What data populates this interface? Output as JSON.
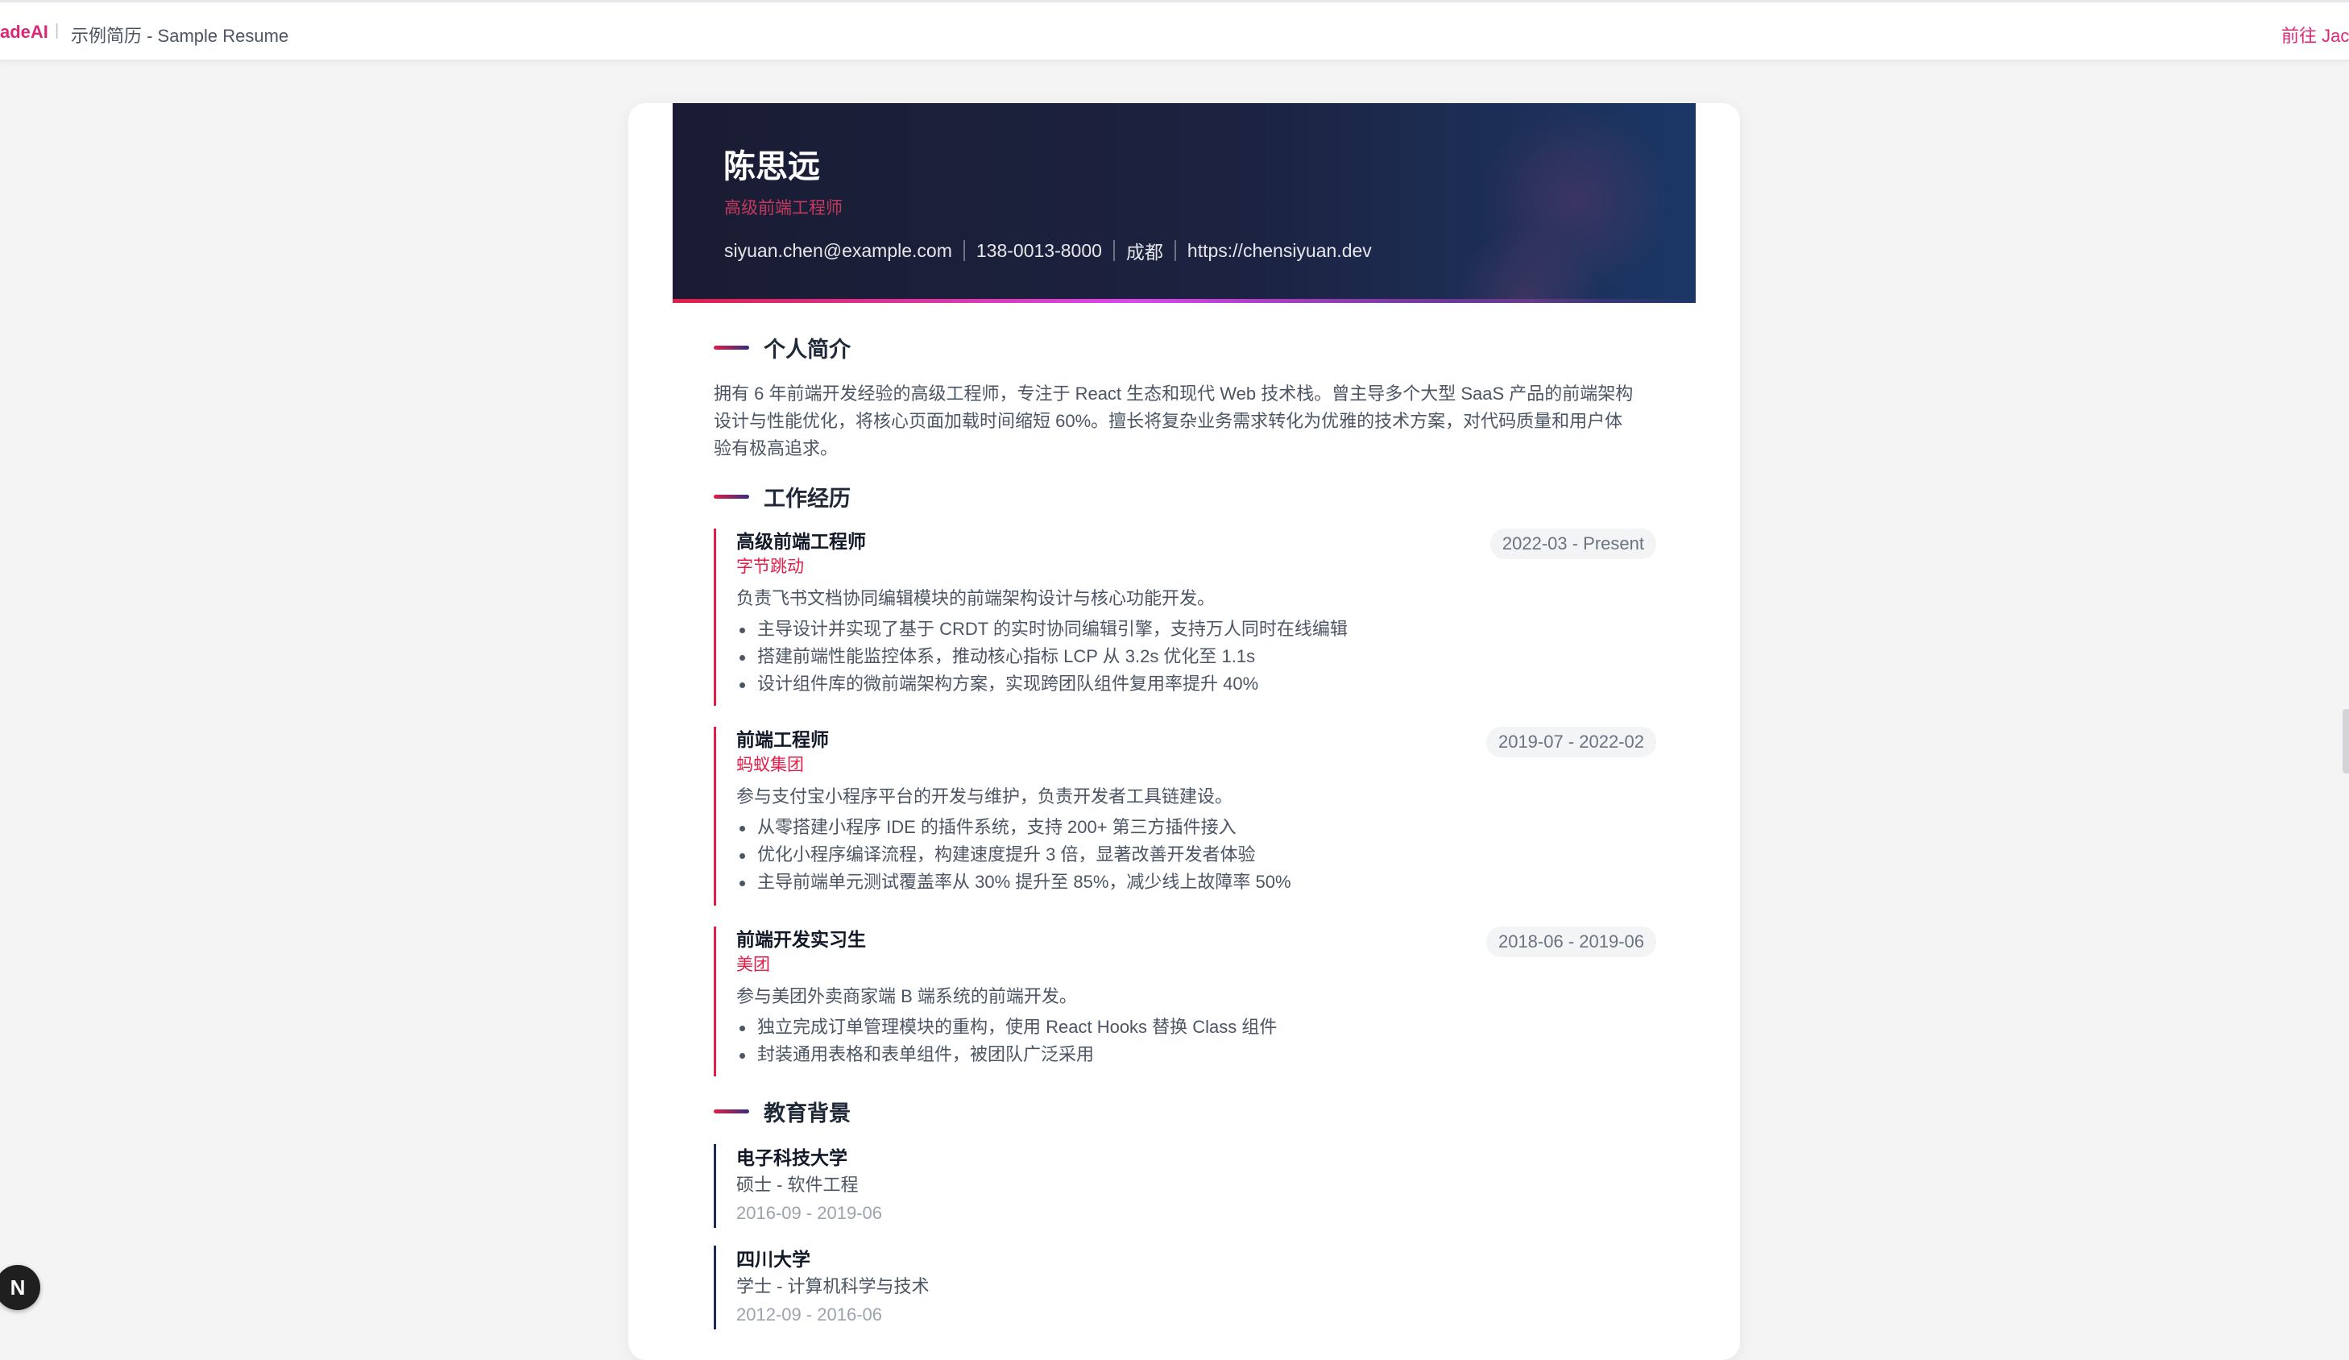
{
  "topbar": {
    "brand": "adeAI",
    "separator": "|",
    "breadcrumb": "示例简历 - Sample Resume",
    "goto_label": "前往 Jac"
  },
  "resume": {
    "name": "陈思远",
    "title": "高级前端工程师",
    "contacts": {
      "email": "siyuan.chen@example.com",
      "phone": "138-0013-8000",
      "city": "成都",
      "website": "https://chensiyuan.dev"
    },
    "sections": {
      "summary_title": "个人简介",
      "experience_title": "工作经历",
      "education_title": "教育背景"
    },
    "summary": [
      "拥有 6 年前端开发经验的高级工程师，专注于 React 生态和现代 Web 技术栈。曾主导多个大型 SaaS 产品的前端架构",
      "设计与性能优化，将核心页面加载时间缩短 60%。擅长将复杂业务需求转化为优雅的技术方案，对代码质量和用户体",
      "验有极高追求。"
    ],
    "experience": [
      {
        "title": "高级前端工程师",
        "company": "字节跳动",
        "period": "2022-03 - Present",
        "description": "负责飞书文档协同编辑模块的前端架构设计与核心功能开发。",
        "bullets": [
          "主导设计并实现了基于 CRDT 的实时协同编辑引擎，支持万人同时在线编辑",
          "搭建前端性能监控体系，推动核心指标 LCP 从 3.2s 优化至 1.1s",
          "设计组件库的微前端架构方案，实现跨团队组件复用率提升 40%"
        ]
      },
      {
        "title": "前端工程师",
        "company": "蚂蚁集团",
        "period": "2019-07 - 2022-02",
        "description": "参与支付宝小程序平台的开发与维护，负责开发者工具链建设。",
        "bullets": [
          "从零搭建小程序 IDE 的插件系统，支持 200+ 第三方插件接入",
          "优化小程序编译流程，构建速度提升 3 倍，显著改善开发者体验",
          "主导前端单元测试覆盖率从 30% 提升至 85%，减少线上故障率 50%"
        ]
      },
      {
        "title": "前端开发实习生",
        "company": "美团",
        "period": "2018-06 - 2019-06",
        "description": "参与美团外卖商家端 B 端系统的前端开发。",
        "bullets": [
          "独立完成订单管理模块的重构，使用 React Hooks 替换 Class 组件",
          "封装通用表格和表单组件，被团队广泛采用"
        ]
      }
    ],
    "education": [
      {
        "school": "电子科技大学",
        "degree": "硕士 - 软件工程",
        "period": "2016-09 - 2019-06"
      },
      {
        "school": "四川大学",
        "degree": "学士 - 计算机科学与技术",
        "period": "2012-09 - 2016-06"
      }
    ]
  },
  "floating_badge": "N",
  "colors": {
    "brand": "#db2777",
    "accent": "#e11d48",
    "hero_dark": "#1a1c33",
    "hero_blue": "#1b3766"
  }
}
